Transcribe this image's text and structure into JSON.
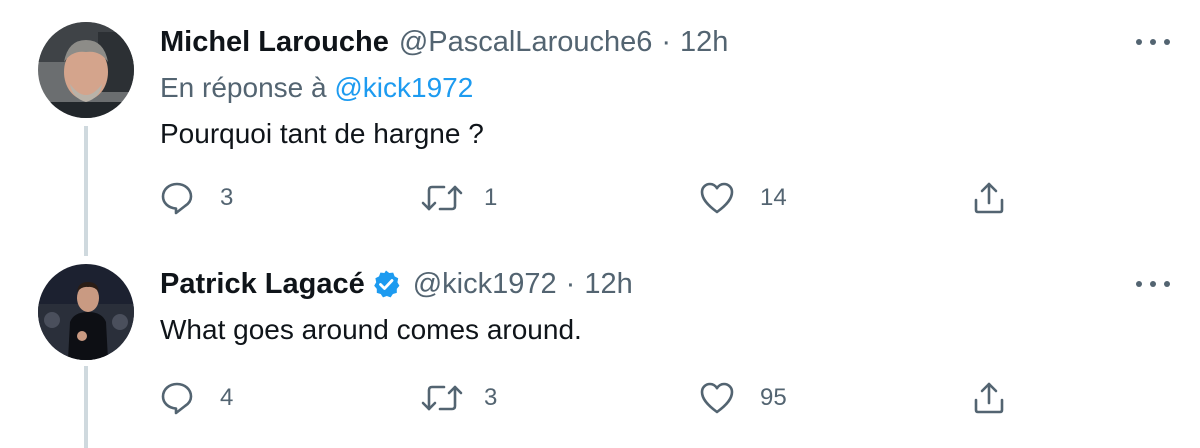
{
  "tweets": [
    {
      "author_name": "Michel Larouche",
      "handle": "@PascalLarouche6",
      "separator": "·",
      "time": "12h",
      "verified": false,
      "reply_prefix": "En réponse à",
      "reply_to": "@kick1972",
      "text": "Pourquoi tant de hargne ?",
      "replies": "3",
      "retweets": "1",
      "likes": "14"
    },
    {
      "author_name": "Patrick Lagacé",
      "handle": "@kick1972",
      "separator": "·",
      "time": "12h",
      "verified": true,
      "text": "What goes around comes around.",
      "replies": "4",
      "retweets": "3",
      "likes": "95"
    }
  ],
  "icons": {
    "reply": "speech-bubble-icon",
    "retweet": "retweet-arrows-icon",
    "like": "heart-icon",
    "share": "share-upload-icon",
    "more": "more-dots-icon",
    "verified": "verified-badge-icon"
  },
  "colors": {
    "text_primary": "#0f1419",
    "text_secondary": "#536471",
    "link": "#1d9bf0",
    "thread_line": "#cfd9de",
    "verified": "#1d9bf0"
  }
}
